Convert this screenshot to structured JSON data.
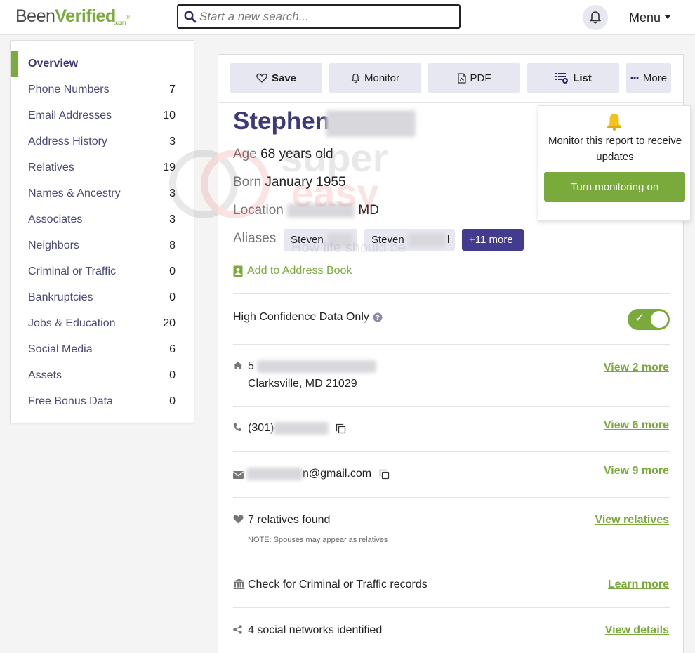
{
  "header": {
    "logo": {
      "been": "Been",
      "verified": "Verified",
      "dotcom": ".com",
      "reg": "®"
    },
    "search_placeholder": "Start a new search...",
    "menu_label": "Menu"
  },
  "sidebar": {
    "items": [
      {
        "label": "Overview",
        "count": ""
      },
      {
        "label": "Phone Numbers",
        "count": "7"
      },
      {
        "label": "Email Addresses",
        "count": "10"
      },
      {
        "label": "Address History",
        "count": "3"
      },
      {
        "label": "Relatives",
        "count": "19"
      },
      {
        "label": "Names & Ancestry",
        "count": "3"
      },
      {
        "label": "Associates",
        "count": "3"
      },
      {
        "label": "Neighbors",
        "count": "8"
      },
      {
        "label": "Criminal or Traffic",
        "count": "0"
      },
      {
        "label": "Bankruptcies",
        "count": "0"
      },
      {
        "label": "Jobs & Education",
        "count": "20"
      },
      {
        "label": "Social Media",
        "count": "6"
      },
      {
        "label": "Assets",
        "count": "0"
      },
      {
        "label": "Free Bonus Data",
        "count": "0"
      }
    ]
  },
  "toolbar": {
    "save": "Save",
    "monitor": "Monitor",
    "pdf": "PDF",
    "list": "List",
    "more": "More"
  },
  "profile": {
    "first_name": "Stephen",
    "age_key": "Age",
    "age_value": "68 years old",
    "born_key": "Born",
    "born_value": "January 1955",
    "location_key": "Location",
    "location_value": "MD",
    "aliases_key": "Aliases",
    "alias_1": "Steven",
    "alias_2": "Steven",
    "alias_2_suffix": "l",
    "aliases_more": "+11 more",
    "add_address_book": "Add to Address Book"
  },
  "confidence": {
    "label": "High Confidence Data Only",
    "toggle_check": "✓",
    "enabled": true
  },
  "rows": {
    "address": {
      "prefix": "5",
      "city": "Clarksville, MD 21029",
      "link": "View 2 more"
    },
    "phone": {
      "prefix": "(301)",
      "link": "View 6 more"
    },
    "email": {
      "suffix": "n@gmail.com",
      "link": "View 9 more"
    },
    "relatives": {
      "text": "7 relatives found",
      "note": "NOTE: Spouses may appear as relatives",
      "link": "View relatives"
    },
    "criminal": {
      "text": "Check for Criminal or Traffic records",
      "link": "Learn more"
    },
    "social": {
      "text": "4 social networks identified",
      "link": "View details"
    }
  },
  "popover": {
    "message": "Monitor this report to receive updates",
    "button": "Turn monitoring on"
  },
  "watermark": {
    "line1": "super",
    "line2": "easy",
    "tagline": "How life should be"
  },
  "colors": {
    "accent_green": "#7aaa3c",
    "brand_purple": "#3d3a7a",
    "chip_purple": "#433c8e",
    "button_gray": "#e6e7f0"
  }
}
